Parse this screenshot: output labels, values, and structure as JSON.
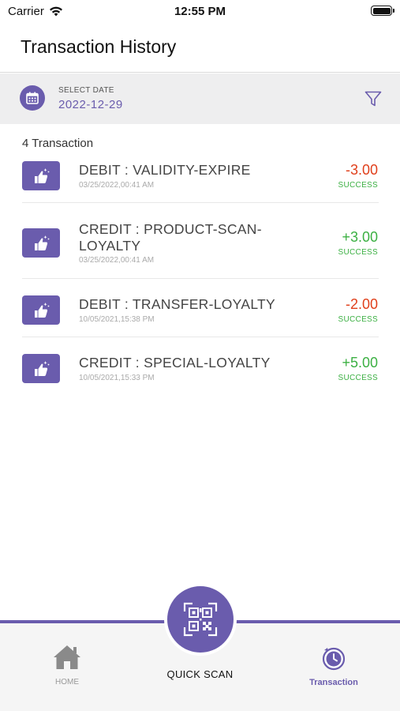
{
  "status_bar": {
    "carrier": "Carrier",
    "time": "12:55 PM"
  },
  "header": {
    "title": "Transaction History"
  },
  "date_filter": {
    "caption": "SELECT DATE",
    "value": "2022-12-29"
  },
  "summary": {
    "count_label": "4 Transaction"
  },
  "colors": {
    "accent": "#6a5cad",
    "debit": "#e0401c",
    "credit": "#3cb043"
  },
  "transactions": [
    {
      "title": "DEBIT : VALIDITY-EXPIRE",
      "date": "03/25/2022,00:41 AM",
      "amount": "-3.00",
      "status": "SUCCESS",
      "kind": "debit",
      "icon": "thumbs-up-sparkle-icon"
    },
    {
      "title": "CREDIT : PRODUCT-SCAN-LOYALTY",
      "date": "03/25/2022,00:41 AM",
      "amount": "+3.00",
      "status": "SUCCESS",
      "kind": "credit",
      "icon": "thumbs-up-sparkle-icon"
    },
    {
      "title": "DEBIT : TRANSFER-LOYALTY",
      "date": "10/05/2021,15:38 PM",
      "amount": "-2.00",
      "status": "SUCCESS",
      "kind": "debit",
      "icon": "thumbs-up-sparkle-icon"
    },
    {
      "title": "CREDIT : SPECIAL-LOYALTY",
      "date": "10/05/2021,15:33 PM",
      "amount": "+5.00",
      "status": "SUCCESS",
      "kind": "credit",
      "icon": "thumbs-up-sparkle-icon"
    }
  ],
  "tabbar": {
    "home_label": "HOME",
    "scan_label": "QUICK SCAN",
    "transaction_label": "Transaction"
  }
}
